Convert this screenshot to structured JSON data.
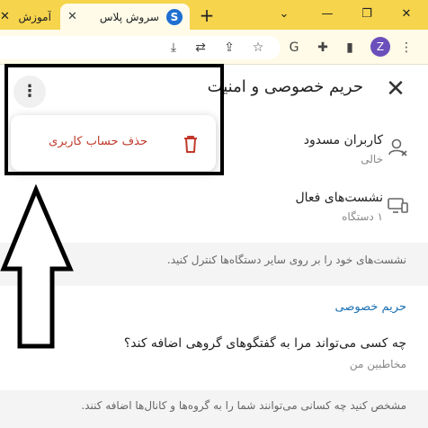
{
  "browser": {
    "tabs": [
      {
        "label": "آموزش ح",
        "active": false
      },
      {
        "label": "سروش پلاس",
        "active": true,
        "logo_glyph": "S"
      }
    ],
    "new_tab_label": "+",
    "avatar_letter": "Z",
    "accent_color": "#f6d44c"
  },
  "header": {
    "title": "حریم خصوصی و امنیت"
  },
  "popup_menu": {
    "items": [
      {
        "label": "حذف حساب کاربری",
        "icon": "trash-icon",
        "color": "#c0392b"
      }
    ]
  },
  "security": {
    "rows": [
      {
        "title": "کاربران مسدود",
        "subtitle": "خالی",
        "icon": "blocked-user-icon"
      },
      {
        "title": "نشست‌های فعال",
        "subtitle": "۱ دستگاه",
        "icon": "devices-icon"
      }
    ],
    "note": "نشست‌های خود را بر روی سایر دستگاه‌ها کنترل کنید."
  },
  "privacy": {
    "section_title": "حریم خصوصی",
    "question": "چه کسی می‌تواند مرا به گفتگوهای گروهی اضافه کند؟",
    "answer": "مخاطبین من",
    "note": "مشخص کنید چه کسانی می‌توانند شما را به گروه‌ها و کانال‌ها اضافه کنند."
  }
}
